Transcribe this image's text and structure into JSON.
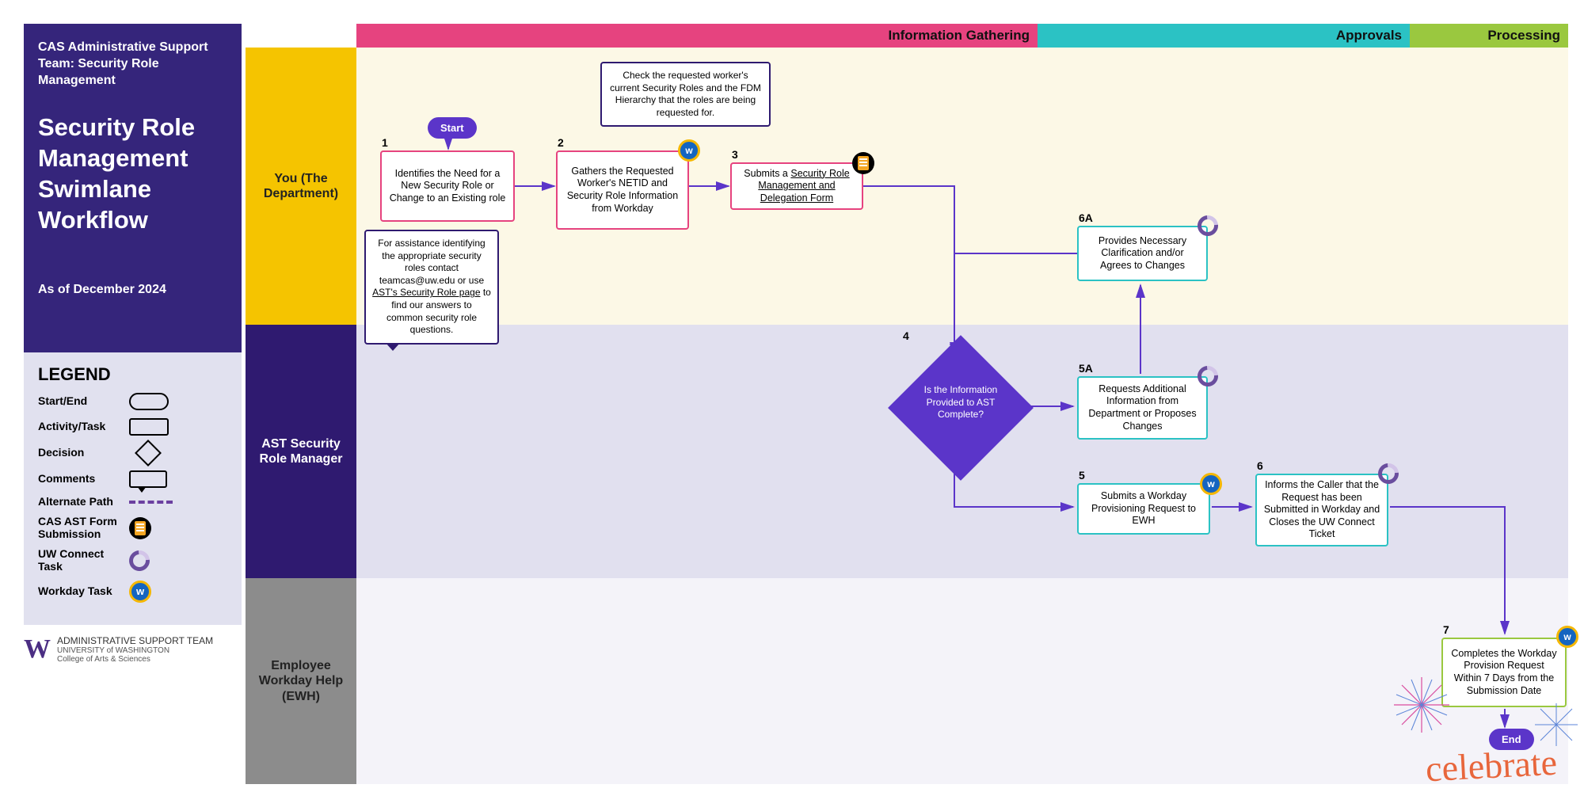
{
  "header": {
    "team_label": "CAS Administrative Support Team: Security Role Management",
    "title": "Security Role Management Swimlane Workflow",
    "as_of": "As of December 2024"
  },
  "legend": {
    "title": "LEGEND",
    "start_end": "Start/End",
    "activity": "Activity/Task",
    "decision": "Decision",
    "comments": "Comments",
    "alt_path": "Alternate Path",
    "form": "CAS AST Form Submission",
    "connect": "UW Connect Task",
    "workday": "Workday Task"
  },
  "footer": {
    "org1": "ADMINISTRATIVE SUPPORT TEAM",
    "org2": "UNIVERSITY of WASHINGTON",
    "org3": "College of Arts & Sciences"
  },
  "lanes": {
    "lane1": "You (The Department)",
    "lane2": "AST Security Role Manager",
    "lane3": "Employee Workday Help (EWH)"
  },
  "phases": {
    "p1": "Information Gathering",
    "p2": "Approvals",
    "p3": "Processing"
  },
  "nodes": {
    "start": "Start",
    "end": "End",
    "n1_num": "1",
    "n1": "Identifies the Need for a New Security Role or Change to an Existing role",
    "n1_callout_a": "For assistance identifying the appropriate security roles contact teamcas@uw.edu or use ",
    "n1_callout_link": "AST's Security Role page",
    "n1_callout_b": " to find our answers to common security role questions.",
    "n2_num": "2",
    "n2": "Gathers the Requested Worker's NETID and Security Role Information from Workday",
    "n2_callout": "Check the requested worker's current Security Roles and the FDM Hierarchy that the roles are being requested for.",
    "n3_num": "3",
    "n3_a": "Submits a ",
    "n3_link": "Security Role Management and Delegation Form",
    "n4_num": "4",
    "n4": "Is the Information Provided to AST Complete?",
    "n5_num": "5",
    "n5": "Submits a Workday Provisioning Request to EWH",
    "n5a_num": "5A",
    "n5a": "Requests Additional Information from Department or Proposes Changes",
    "n6_num": "6",
    "n6": "Informs the Caller that the Request has been Submitted in Workday and Closes the UW Connect Ticket",
    "n6a_num": "6A",
    "n6a": "Provides Necessary Clarification and/or Agrees to Changes",
    "n7_num": "7",
    "n7": "Completes the Workday Provision Request Within 7 Days from the Submission Date",
    "celebrate": "celebrate"
  }
}
